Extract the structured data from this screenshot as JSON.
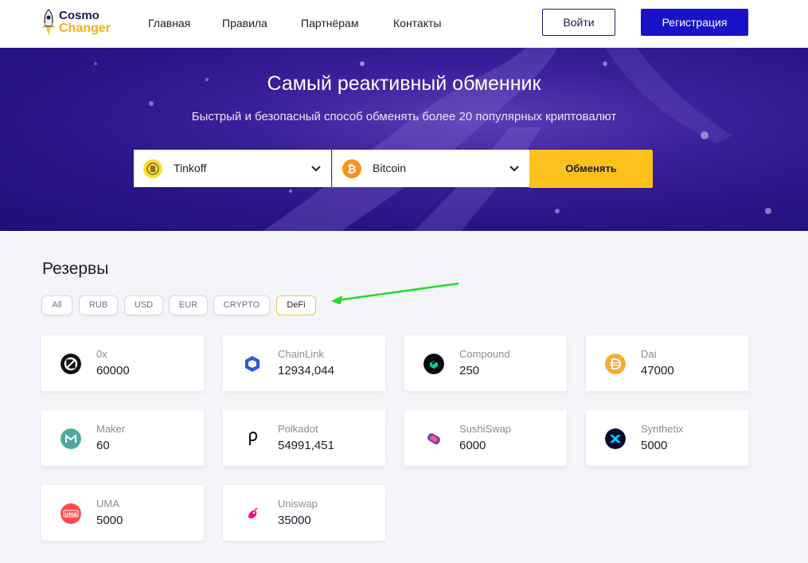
{
  "logo": {
    "line1": "Cosmo",
    "line2": "Changer"
  },
  "nav": [
    "Главная",
    "Правила",
    "Партнёрам",
    "Контакты"
  ],
  "auth": {
    "login": "Войти",
    "register": "Регистрация"
  },
  "hero": {
    "title": "Самый реактивный обменник",
    "subtitle": "Быстрый и безопасный способ обменять более 20 популярных криптовалют",
    "from": {
      "label": "Tinkoff",
      "icon": "tinkoff-icon"
    },
    "to": {
      "label": "Bitcoin",
      "icon": "bitcoin-icon"
    },
    "exchange_label": "Обменять"
  },
  "reserves": {
    "title": "Резервы",
    "filters": [
      "All",
      "RUB",
      "USD",
      "EUR",
      "CRYPTO",
      "DeFi"
    ],
    "active_filter": "DeFi",
    "items": [
      {
        "name": "0x",
        "value": "60000",
        "icon": "0x-icon",
        "color": "#111111"
      },
      {
        "name": "ChainLink",
        "value": "12934,044",
        "icon": "chainlink-icon",
        "color": "#2a5ada"
      },
      {
        "name": "Compound",
        "value": "250",
        "icon": "compound-icon",
        "color": "#070a0e"
      },
      {
        "name": "Dai",
        "value": "47000",
        "icon": "dai-icon",
        "color": "#f5ac37"
      },
      {
        "name": "Maker",
        "value": "60",
        "icon": "maker-icon",
        "color": "#4fa89b"
      },
      {
        "name": "Polkadot",
        "value": "54991,451",
        "icon": "polkadot-icon",
        "color": "#111111"
      },
      {
        "name": "SushiSwap",
        "value": "6000",
        "icon": "sushiswap-icon",
        "color": "#6e3fa3"
      },
      {
        "name": "Synthetix",
        "value": "5000",
        "icon": "synthetix-icon",
        "color": "#0a0a2a"
      },
      {
        "name": "UMA",
        "value": "5000",
        "icon": "uma-icon",
        "color": "#ff4a4a"
      },
      {
        "name": "Uniswap",
        "value": "35000",
        "icon": "uniswap-icon",
        "color": "#ff007a"
      }
    ]
  },
  "colors": {
    "accent": "#1a12c8",
    "cta": "#fcc21b",
    "annotation_arrow": "#22dd22"
  }
}
